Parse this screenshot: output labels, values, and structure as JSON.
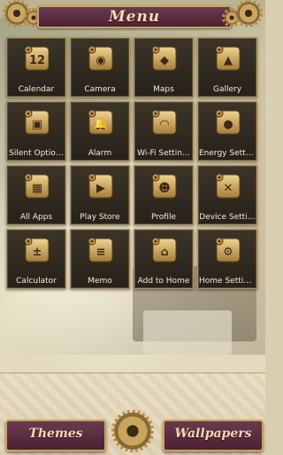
{
  "header": {
    "title": "Menu"
  },
  "apps": [
    {
      "label": "Calendar",
      "icon": "calendar-icon",
      "glyph": "12"
    },
    {
      "label": "Camera",
      "icon": "camera-icon",
      "glyph": "◉"
    },
    {
      "label": "Maps",
      "icon": "map-pin-icon",
      "glyph": "◆"
    },
    {
      "label": "Gallery",
      "icon": "gallery-icon",
      "glyph": "▲"
    },
    {
      "label": "Silent Optio…",
      "icon": "silent-options-icon",
      "glyph": "▣"
    },
    {
      "label": "Alarm",
      "icon": "bell-icon",
      "glyph": "🔔"
    },
    {
      "label": "Wi-Fi Settin…",
      "icon": "wifi-icon",
      "glyph": "◠"
    },
    {
      "label": "Energy Setti…",
      "icon": "lightbulb-icon",
      "glyph": "●"
    },
    {
      "label": "All Apps",
      "icon": "all-apps-icon",
      "glyph": "▦"
    },
    {
      "label": "Play Store",
      "icon": "play-store-icon",
      "glyph": "▶"
    },
    {
      "label": "Profile",
      "icon": "profile-icon",
      "glyph": "☻"
    },
    {
      "label": "Device Setti…",
      "icon": "tools-icon",
      "glyph": "✕"
    },
    {
      "label": "Calculator",
      "icon": "calculator-icon",
      "glyph": "±"
    },
    {
      "label": "Memo",
      "icon": "memo-icon",
      "glyph": "≡"
    },
    {
      "label": "Add to Home",
      "icon": "add-home-icon",
      "glyph": "⌂"
    },
    {
      "label": "Home Settin…",
      "icon": "home-settings-icon",
      "glyph": "⚙"
    }
  ],
  "bottom": {
    "themes_label": "Themes",
    "wallpapers_label": "Wallpapers"
  },
  "colors": {
    "accent_gold": "#c8a35a",
    "plum": "#4b2233",
    "tile": "#26211a"
  }
}
